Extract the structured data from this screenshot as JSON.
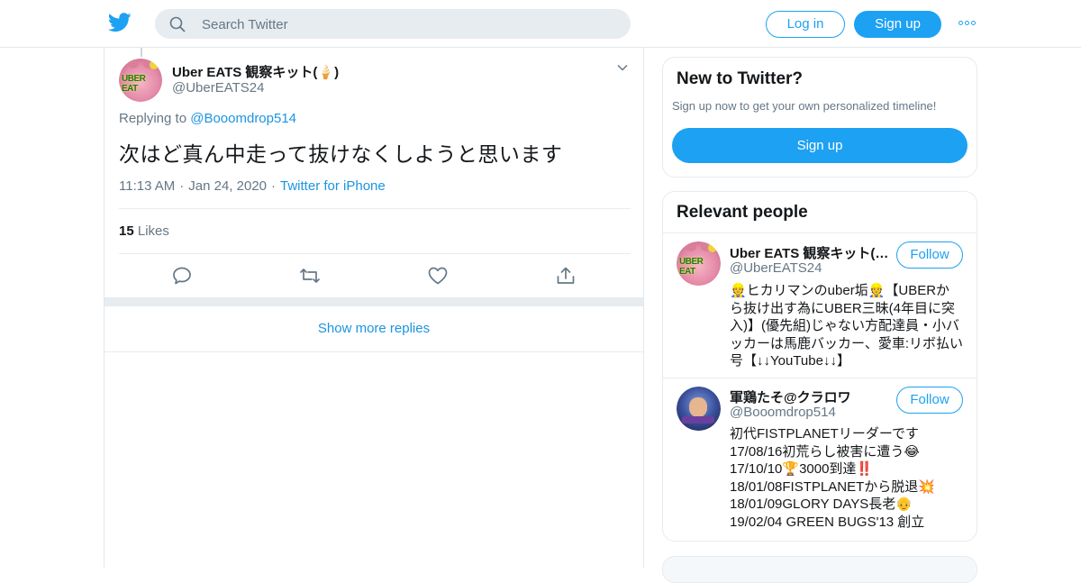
{
  "header": {
    "search_placeholder": "Search Twitter",
    "login_label": "Log in",
    "signup_label": "Sign up",
    "brand_color": "#1da1f2"
  },
  "tweet": {
    "author_name": "Uber EATS 観察キット(🍦)",
    "author_handle": "@UberEATS24",
    "replying_prefix": "Replying to",
    "replying_to": "@Booomdrop514",
    "text": "次はど真ん中走って抜けなくしようと思います",
    "time": "11:13 AM",
    "date": "Jan 24, 2020",
    "source": "Twitter for iPhone",
    "likes_count": "15",
    "likes_label": "Likes",
    "actions": [
      "reply-icon",
      "retweet-icon",
      "like-icon",
      "share-icon"
    ]
  },
  "replies": {
    "show_more_label": "Show more replies"
  },
  "sidebar": {
    "new_card": {
      "title": "New to Twitter?",
      "subtitle": "Sign up now to get your own personalized timeline!",
      "signup_label": "Sign up"
    },
    "relevant": {
      "title": "Relevant people",
      "people": [
        {
          "name": "Uber EATS 観察キット(🍦)",
          "handle": "@UberEATS24",
          "follow_label": "Follow",
          "bio": [
            "👷ヒカリマンのuber垢👷【UBERか",
            "ら抜け出す為にUBER三昧(4年目に突",
            "入)】(優先組)じゃない方配達員・小バ",
            "ッカーは馬鹿バッカー、愛車:リボ払い",
            "号【↓↓YouTube↓↓】"
          ]
        },
        {
          "name": "軍鶏たそ@クラロワ",
          "handle": "@Booomdrop514",
          "follow_label": "Follow",
          "bio": [
            "初代FISTPLANETリーダーです",
            "17/08/16初荒らし被害に遭う😂",
            "17/10/10🏆3000到達‼️",
            "18/01/08FISTPLANETから脱退💥",
            "18/01/09GLORY DAYS長老👴",
            "19/02/04 GREEN BUGS'13 創立"
          ]
        }
      ]
    }
  }
}
